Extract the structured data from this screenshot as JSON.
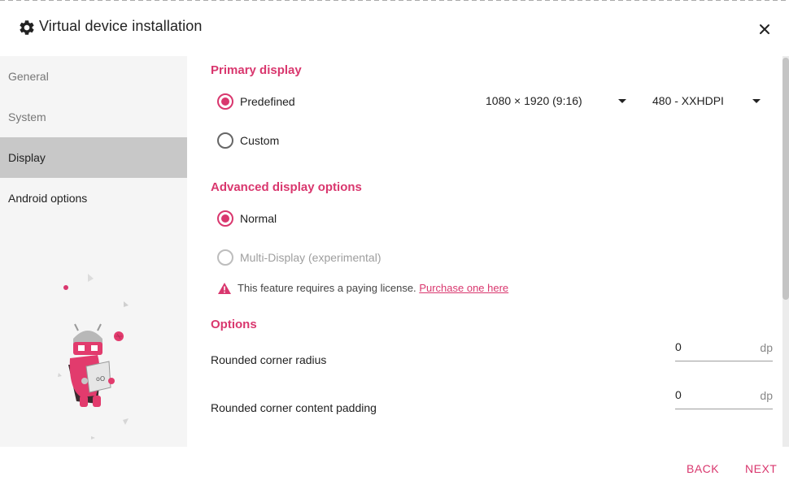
{
  "window": {
    "title": "Virtual device installation",
    "title_icon": "gear-icon",
    "close_icon": "close-icon"
  },
  "sidebar": {
    "items": [
      {
        "label": "General",
        "active": false
      },
      {
        "label": "System",
        "active": false
      },
      {
        "label": "Display",
        "active": true
      },
      {
        "label": "Android options",
        "active": false
      }
    ]
  },
  "primary_display": {
    "heading": "Primary display",
    "predefined_label": "Predefined",
    "custom_label": "Custom",
    "selected": "Predefined",
    "resolution_value": "1080 × 1920 (9:16)",
    "density_value": "480 - XXHDPI"
  },
  "advanced_display": {
    "heading": "Advanced display options",
    "normal_label": "Normal",
    "multi_label": "Multi-Display (experimental)",
    "selected": "Normal",
    "warning_text": "This feature requires a paying license.",
    "warning_link": "Purchase one here"
  },
  "options": {
    "heading": "Options",
    "corner_radius_label": "Rounded corner radius",
    "corner_radius_value": "0",
    "corner_radius_unit": "dp",
    "corner_padding_label": "Rounded corner content padding",
    "corner_padding_value": "0",
    "corner_padding_unit": "dp"
  },
  "footer": {
    "back_label": "BACK",
    "next_label": "NEXT"
  },
  "colors": {
    "accent": "#d9376e",
    "sidebar_bg": "#f5f5f5",
    "sidebar_active": "#c8c8c8"
  }
}
